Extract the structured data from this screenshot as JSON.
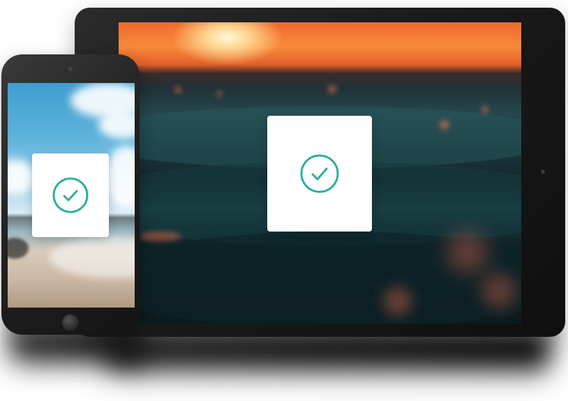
{
  "colors": {
    "check_accent": "#2bb09a",
    "device_body": "#1a1a1a",
    "card_background": "#ffffff"
  },
  "devices": {
    "tablet": {
      "icon": "checkmark-circle-icon"
    },
    "phone": {
      "icon": "checkmark-circle-icon"
    }
  }
}
